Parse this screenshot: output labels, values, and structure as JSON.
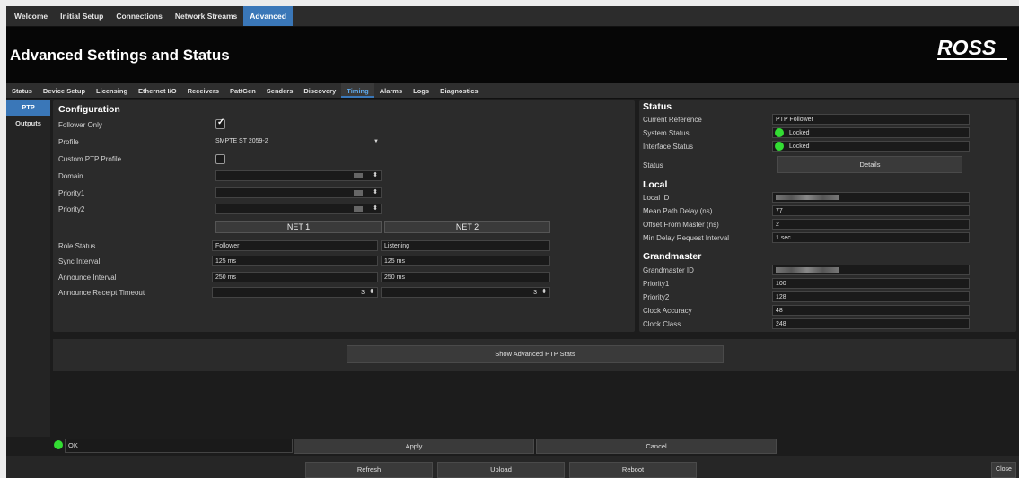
{
  "top_tabs": [
    "Welcome",
    "Initial Setup",
    "Connections",
    "Network Streams",
    "Advanced"
  ],
  "header": {
    "title": "Advanced Settings and Status",
    "logo_text": "ROSS"
  },
  "sub_tabs": [
    "Status",
    "Device Setup",
    "Licensing",
    "Ethernet I/O",
    "Receivers",
    "PattGen",
    "Senders",
    "Discovery",
    "Timing",
    "Alarms",
    "Logs",
    "Diagnostics"
  ],
  "side_tabs": [
    "PTP",
    "Outputs"
  ],
  "config": {
    "heading": "Configuration",
    "follower_only_label": "Follower Only",
    "follower_only_checked": true,
    "profile_label": "Profile",
    "profile_value": "SMPTE ST 2059-2",
    "custom_ptp_label": "Custom PTP Profile",
    "domain_label": "Domain",
    "priority1_label": "Priority1",
    "priority2_label": "Priority2",
    "net1_label": "NET 1",
    "net2_label": "NET 2",
    "role_status_label": "Role Status",
    "role_status_net1": "Follower",
    "role_status_net2": "Listening",
    "sync_interval_label": "Sync Interval",
    "sync_interval_net1": "125 ms",
    "sync_interval_net2": "125 ms",
    "announce_interval_label": "Announce Interval",
    "announce_interval_net1": "250 ms",
    "announce_interval_net2": "250 ms",
    "announce_timeout_label": "Announce Receipt Timeout",
    "announce_timeout_net1": "3",
    "announce_timeout_net2": "3"
  },
  "status": {
    "heading": "Status",
    "current_reference_label": "Current Reference",
    "current_reference_value": "PTP Follower",
    "system_status_label": "System Status",
    "system_status_value": "Locked",
    "interface_status_label": "Interface Status",
    "interface_status_value": "Locked",
    "status_label": "Status",
    "details_button": "Details",
    "local_heading": "Local",
    "local_id_label": "Local ID",
    "mean_path_delay_label": "Mean Path Delay (ns)",
    "mean_path_delay_value": "77",
    "offset_label": "Offset From Master (ns)",
    "offset_value": "2",
    "min_delay_label": "Min Delay Request Interval",
    "min_delay_value": "1 sec",
    "grandmaster_heading": "Grandmaster",
    "gm_id_label": "Grandmaster ID",
    "gm_priority1_label": "Priority1",
    "gm_priority1_value": "100",
    "gm_priority2_label": "Priority2",
    "gm_priority2_value": "128",
    "clock_accuracy_label": "Clock Accuracy",
    "clock_accuracy_value": "48",
    "clock_class_label": "Clock Class",
    "clock_class_value": "248"
  },
  "advanced_button": "Show Advanced PTP Stats",
  "footer": {
    "status_text": "OK",
    "apply_label": "Apply",
    "cancel_label": "Cancel"
  },
  "bottom": {
    "refresh_label": "Refresh",
    "upload_label": "Upload",
    "reboot_label": "Reboot",
    "close_label": "Close"
  },
  "colors": {
    "accent": "#3a77b8",
    "led_green": "#33dd33",
    "header_bg": "#060606"
  }
}
